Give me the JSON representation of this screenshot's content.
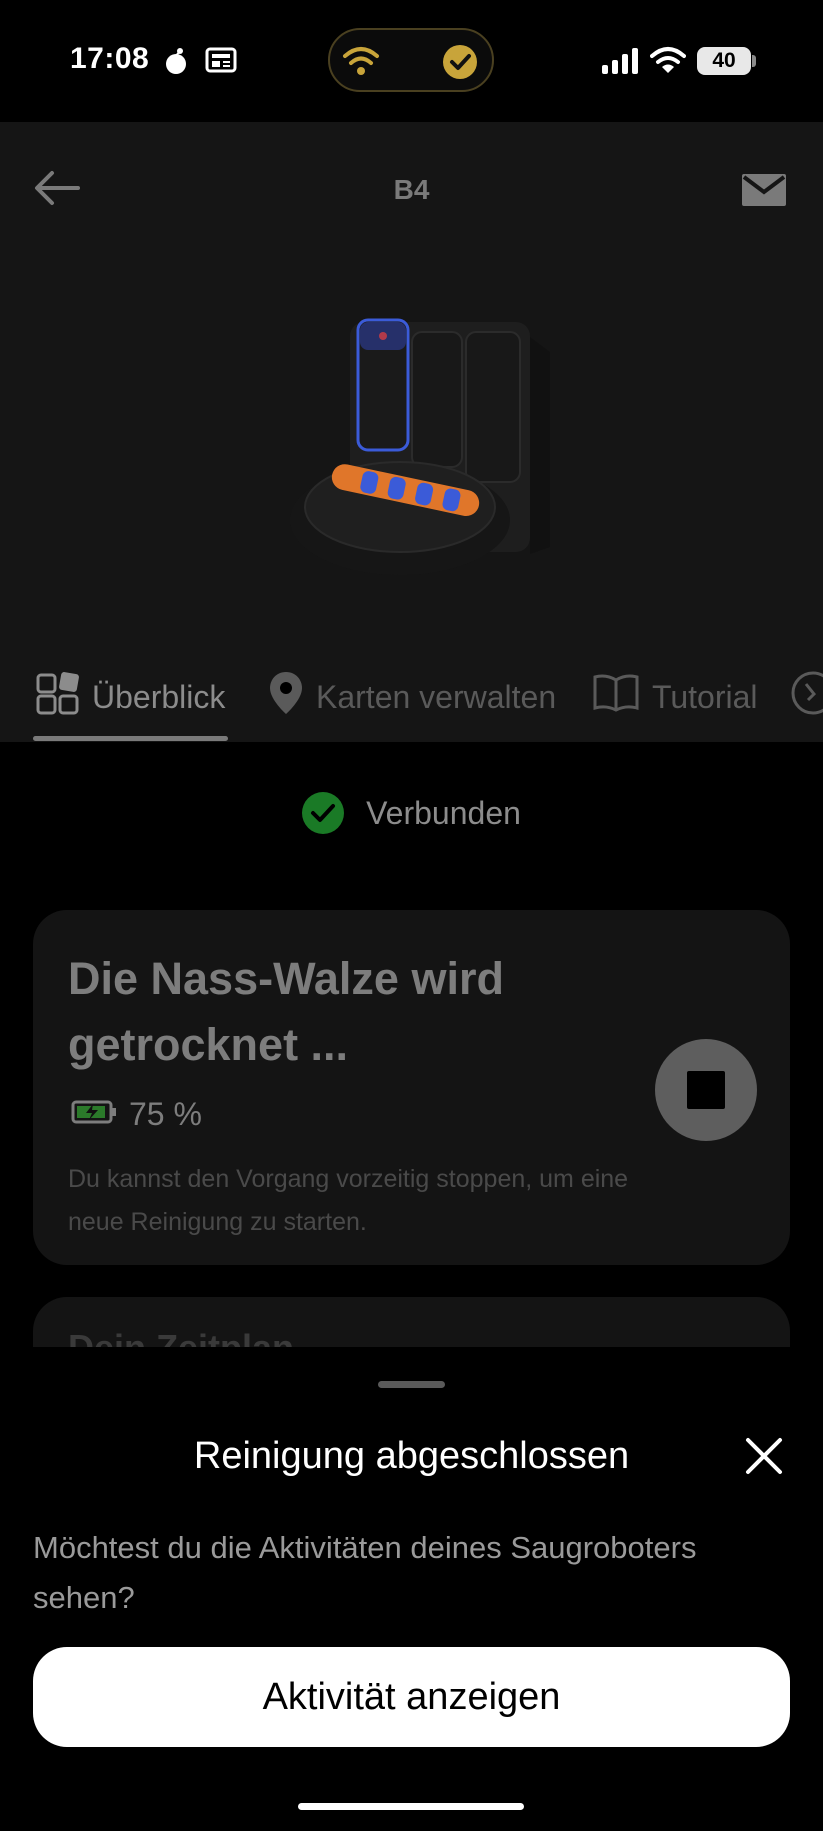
{
  "status_bar": {
    "time": "17:08",
    "battery": "40"
  },
  "header": {
    "title": "B4"
  },
  "tabs": [
    {
      "label": "Überblick",
      "icon": "overview-grid-icon"
    },
    {
      "label": "Karten verwalten",
      "icon": "location-pin-icon"
    },
    {
      "label": "Tutorial",
      "icon": "book-icon"
    },
    {
      "label": "",
      "icon": "compass-icon"
    }
  ],
  "connection": {
    "label": "Verbunden"
  },
  "status_card": {
    "title": "Die Nass-Walze wird getrocknet ...",
    "battery_level": "75 %",
    "hint": "Du kannst den Vorgang vorzeitig stoppen, um eine neue Reinigung zu starten."
  },
  "second_card": {
    "title": "Dein Zeitplan"
  },
  "sheet": {
    "title": "Reinigung abgeschlossen",
    "text": "Möchtest du die Aktivitäten deines Saugroboters sehen?",
    "primary_button": "Aktivität anzeigen"
  },
  "colors": {
    "accent_gold": "#c8a43a",
    "connected_green": "#1a7a26",
    "robot_blue": "#3b5bd8",
    "robot_orange": "#e0762a"
  }
}
